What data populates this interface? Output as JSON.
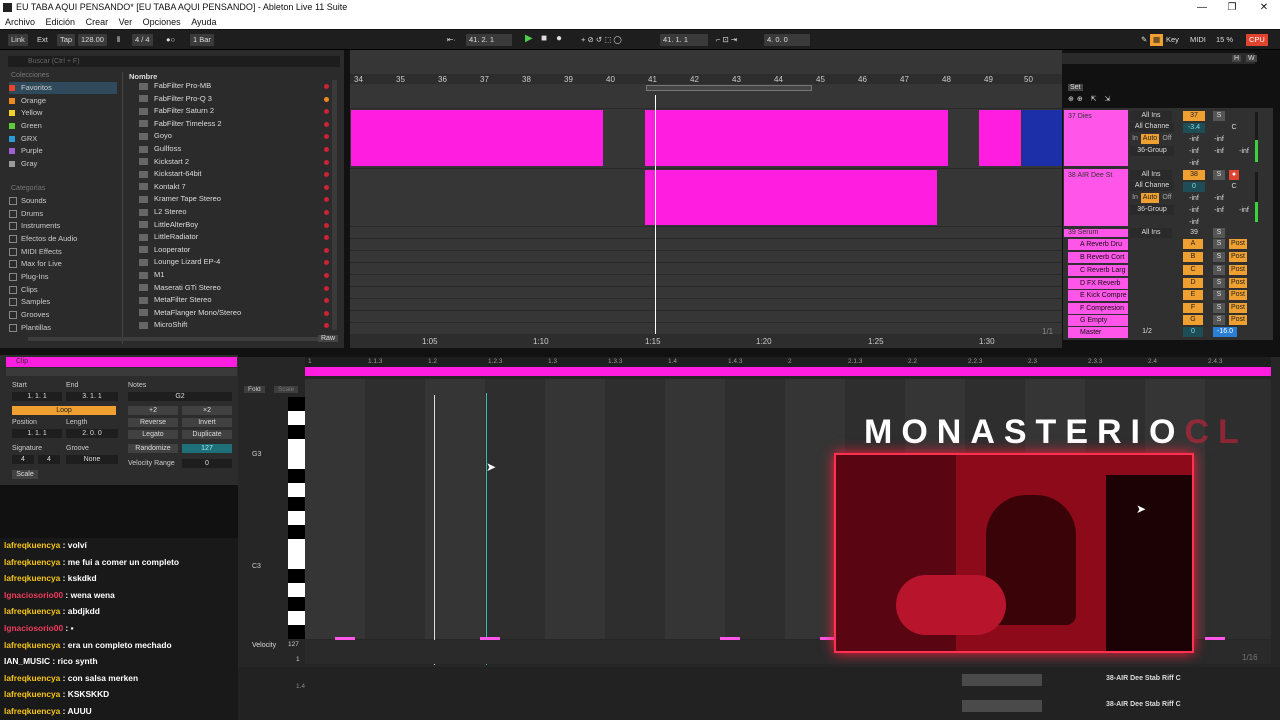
{
  "window": {
    "title": "EU TABA AQUI PENSANDO* [EU TABA AQUI PENSANDO] - Ableton Live 11 Suite",
    "controls": [
      "—",
      "❐",
      "✕"
    ]
  },
  "menu": [
    "Archivo",
    "Edición",
    "Crear",
    "Ver",
    "Opciones",
    "Ayuda"
  ],
  "transport": {
    "link": "Link",
    "ext": "Ext",
    "tap": "Tap",
    "tempo": "128.00",
    "signature": "4 / 4",
    "quantize": "1 Bar",
    "position": "41.  2.  1",
    "loop_start": "41.  1.  1",
    "loop_length": "4.  0.  0",
    "key": "Key",
    "midi": "MIDI",
    "cpu": "15 %",
    "cpu_label": "CPU"
  },
  "browser": {
    "search_placeholder": "Buscar (Ctrl + F)",
    "collections_header": "Colecciones",
    "collections": [
      {
        "label": "Favoritos",
        "color": "#e8452c"
      },
      {
        "label": "Orange",
        "color": "#f08a1e"
      },
      {
        "label": "Yellow",
        "color": "#efd128"
      },
      {
        "label": "Green",
        "color": "#5ecb3a"
      },
      {
        "label": "GRX",
        "color": "#2a9bd6"
      },
      {
        "label": "Purple",
        "color": "#a25fd5"
      },
      {
        "label": "Gray",
        "color": "#9a9a9a"
      }
    ],
    "categories_header": "Categorías",
    "categories": [
      "Sounds",
      "Drums",
      "Instruments",
      "Efectos de Audio",
      "MIDI Effects",
      "Max for Live",
      "Plug-Ins",
      "Clips",
      "Samples",
      "Grooves",
      "Plantillas"
    ],
    "name_header": "Nombre",
    "items": [
      "FabFilter Pro-MB",
      "FabFilter Pro-Q 3",
      "FabFilter Saturn 2",
      "FabFilter Timeless 2",
      "Goyo",
      "Gullfoss",
      "Kickstart 2",
      "Kickstart-64bit",
      "Kontakt 7",
      "Kramer Tape Stereo",
      "L2 Stereo",
      "LittleAlterBoy",
      "LittleRadiator",
      "Looperator",
      "Lounge Lizard EP-4",
      "M1",
      "Maserati GTi Stereo",
      "MetaFilter Stereo",
      "MetaFlanger Mono/Stereo",
      "MicroShift"
    ],
    "raw_label": "Raw"
  },
  "arrangement": {
    "bars": [
      "34",
      "35",
      "36",
      "37",
      "38",
      "39",
      "40",
      "41",
      "42",
      "43",
      "44",
      "45",
      "46",
      "47",
      "48",
      "49",
      "50"
    ],
    "time_labels": [
      "1:05",
      "1:10",
      "1:15",
      "1:20",
      "1:25",
      "1:30"
    ],
    "set_label": "Set",
    "page_counter": "1/1"
  },
  "mixer": {
    "tracks": [
      {
        "name": "37 Dies",
        "input": "All Ins",
        "channel": "All Channe",
        "volume": "37",
        "pan": "-3.4",
        "group": "36-Group"
      },
      {
        "name": "38 AIR Dee St",
        "input": "All Ins",
        "channel": "All Channe",
        "volume": "38",
        "pan": "0",
        "group": "36-Group"
      },
      {
        "name": "39 Serum",
        "input": "All Ins",
        "volume": "39"
      }
    ],
    "returns": [
      {
        "name": "A Reverb Dru",
        "letter": "A"
      },
      {
        "name": "B Reverb Cort",
        "letter": "B"
      },
      {
        "name": "C Reverb Larg",
        "letter": "C"
      },
      {
        "name": "D FX Reverb",
        "letter": "D"
      },
      {
        "name": "E Kick Compre",
        "letter": "E"
      },
      {
        "name": "F Compresion",
        "letter": "F"
      },
      {
        "name": "G Empty",
        "letter": "G"
      }
    ],
    "master": {
      "name": "Master",
      "ratio": "1/2",
      "pan": "0",
      "volume": "-16.0"
    },
    "monitor": {
      "in": "In",
      "auto": "Auto",
      "off": "Off"
    },
    "post": "Post",
    "solo": "S",
    "c": "C",
    "inf": "-inf"
  },
  "clip": {
    "header": "Clip",
    "start_label": "Start",
    "start_value": "1.  1.  1",
    "end_label": "End",
    "end_value": "3.  1.  1",
    "loop_label": "Loop",
    "position_label": "Position",
    "position_value": "1.  1.  1",
    "length_label": "Length",
    "length_value": "2.  0.  0",
    "signature_label": "Signature",
    "sig_num": "4",
    "sig_den": "4",
    "groove_label": "Groove",
    "groove_value": "None",
    "scale_label": "Scale",
    "notes_label": "Notes",
    "note_value": "G2",
    "plus2": "+2",
    "times2": "×2",
    "reverse": "Reverse",
    "invert": "Invert",
    "legato": "Legato",
    "duplicate": "Duplicate",
    "randomize": "Randomize",
    "randomize_value": "127",
    "velocity_range_label": "Velocity Range",
    "velocity_range_value": "0"
  },
  "pianoroll": {
    "fold": "Fold",
    "scale": "Scale",
    "ruler": [
      "1",
      "1.1.3",
      "1.2",
      "1.2.3",
      "1.3",
      "1.3.3",
      "1.4",
      "1.4.3",
      "2",
      "2.1.3",
      "2.2",
      "2.2.3",
      "2.3",
      "2.3.3",
      "2.4",
      "2.4.3"
    ],
    "key_labels": [
      "G3",
      "C3"
    ],
    "velocity_label": "Velocity",
    "vel_max": "127",
    "vel_min": "1",
    "page": "1/16",
    "mini_label": "1.4"
  },
  "chat": [
    {
      "user": "lafreqkuencya",
      "msg": "volví",
      "tone": "y"
    },
    {
      "user": "lafreqkuencya",
      "msg": "me fui a comer un completo",
      "tone": "y"
    },
    {
      "user": "lafreqkuencya",
      "msg": "kskdkd",
      "tone": "y"
    },
    {
      "user": "Ignaciosorio00",
      "msg": "wena wena",
      "tone": "r"
    },
    {
      "user": "lafreqkuencya",
      "msg": "abdjkdd",
      "tone": "y"
    },
    {
      "user": "Ignaciosorio00",
      "msg": "",
      "tone": "r"
    },
    {
      "user": "lafreqkuencya",
      "msg": "era un completo mechado",
      "tone": "y"
    },
    {
      "user": "IAN_MUSIC",
      "msg": "rico synth",
      "tone": "g"
    },
    {
      "user": "lafreqkuencya",
      "msg": "con salsa merken",
      "tone": "y"
    },
    {
      "user": "lafreqkuencya",
      "msg": "KSKSKKD",
      "tone": "y"
    },
    {
      "user": "lafreqkuencya",
      "msg": "AUUU",
      "tone": "y"
    }
  ],
  "overlay": {
    "brand_main": "MONASTERIO",
    "brand_tail": "CL"
  },
  "status": {
    "track_label": "38-AIR Dee Stab Riff C"
  }
}
